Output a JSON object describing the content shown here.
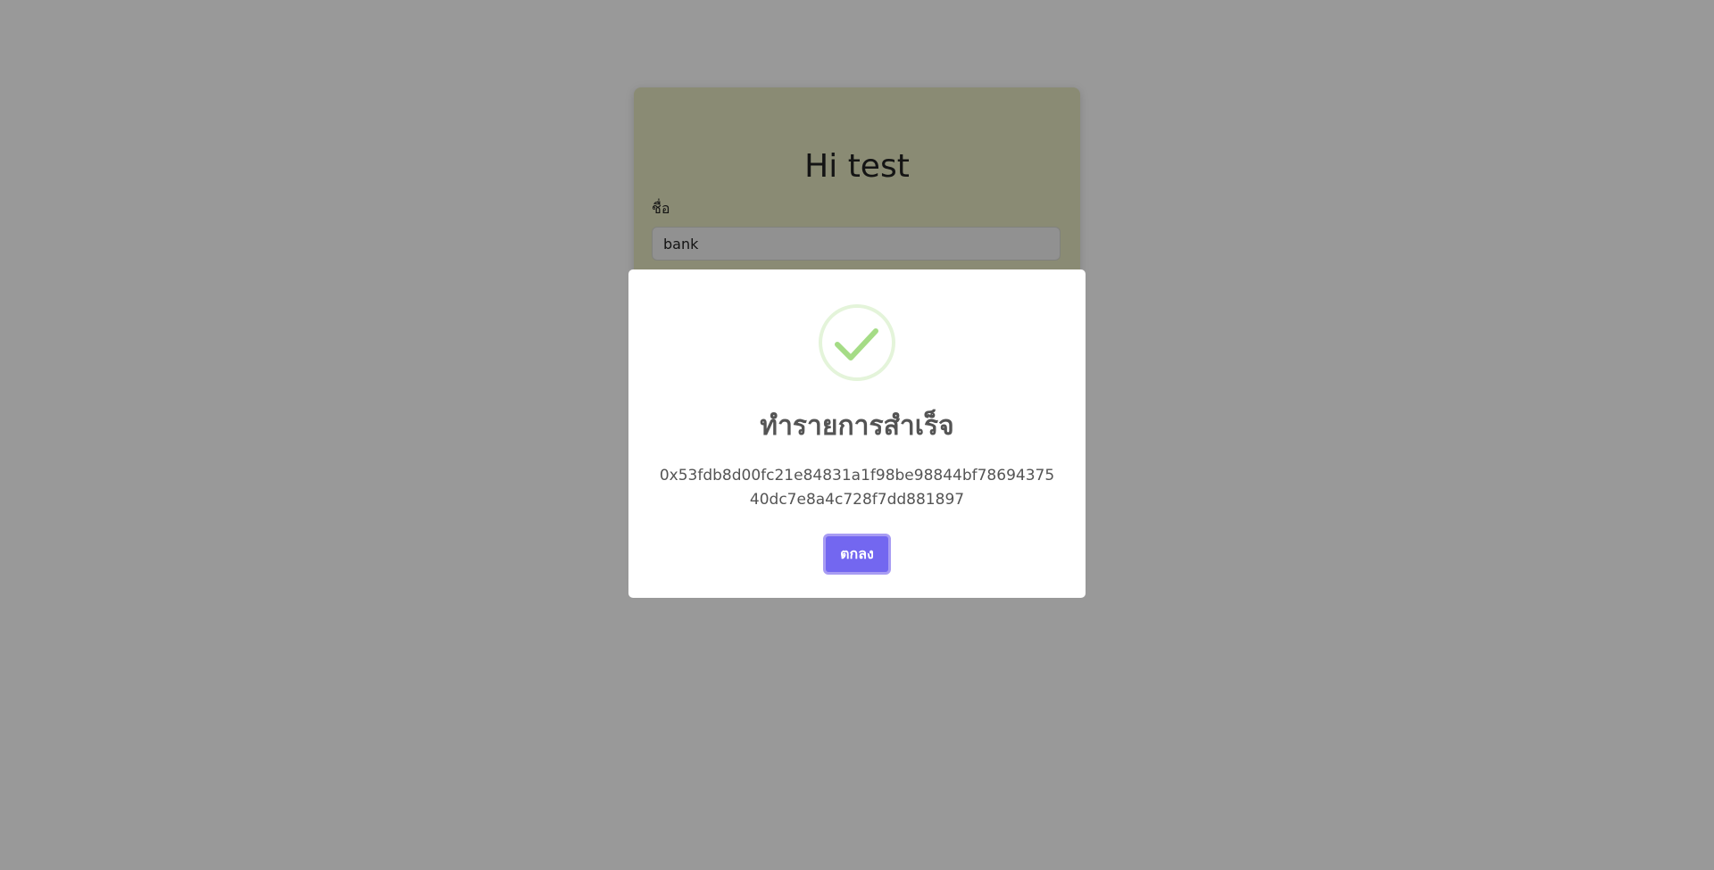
{
  "page": {
    "card": {
      "title": "Hi test",
      "name_label": "ชื่อ",
      "name_value": "bank"
    }
  },
  "modal": {
    "icon": "success-check-icon",
    "title": "ทำรายการสำเร็จ",
    "text": "0x53fdb8d00fc21e84831a1f98be98844bf7869437540dc7e8a4c728f7dd881897",
    "confirm_label": "ตกลง"
  },
  "colors": {
    "card_bg": "#e6e8c2",
    "overlay": "rgba(0,0,0,0.4)",
    "success_green": "#a5dc86",
    "button_bg": "#7367f0",
    "text_gray": "#545454"
  }
}
